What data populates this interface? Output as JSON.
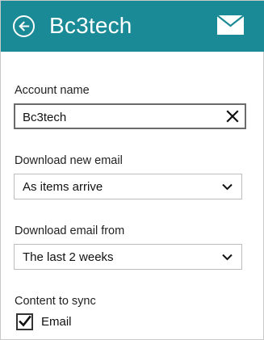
{
  "colors": {
    "header_bg": "#1a8a96",
    "header_text": "#ffffff"
  },
  "header": {
    "title": "Bc3tech",
    "back_icon": "back-arrow-circle-icon",
    "mail_icon": "envelope-icon"
  },
  "account_name": {
    "label": "Account name",
    "value": "Bc3tech",
    "clear_icon": "close-icon"
  },
  "download_new_email": {
    "label": "Download new email",
    "selected": "As items arrive",
    "chevron_icon": "chevron-down-icon"
  },
  "download_email_from": {
    "label": "Download email from",
    "selected": "The last 2 weeks",
    "chevron_icon": "chevron-down-icon"
  },
  "content_to_sync": {
    "label": "Content to sync",
    "items": [
      {
        "label": "Email",
        "checked": true
      }
    ]
  }
}
